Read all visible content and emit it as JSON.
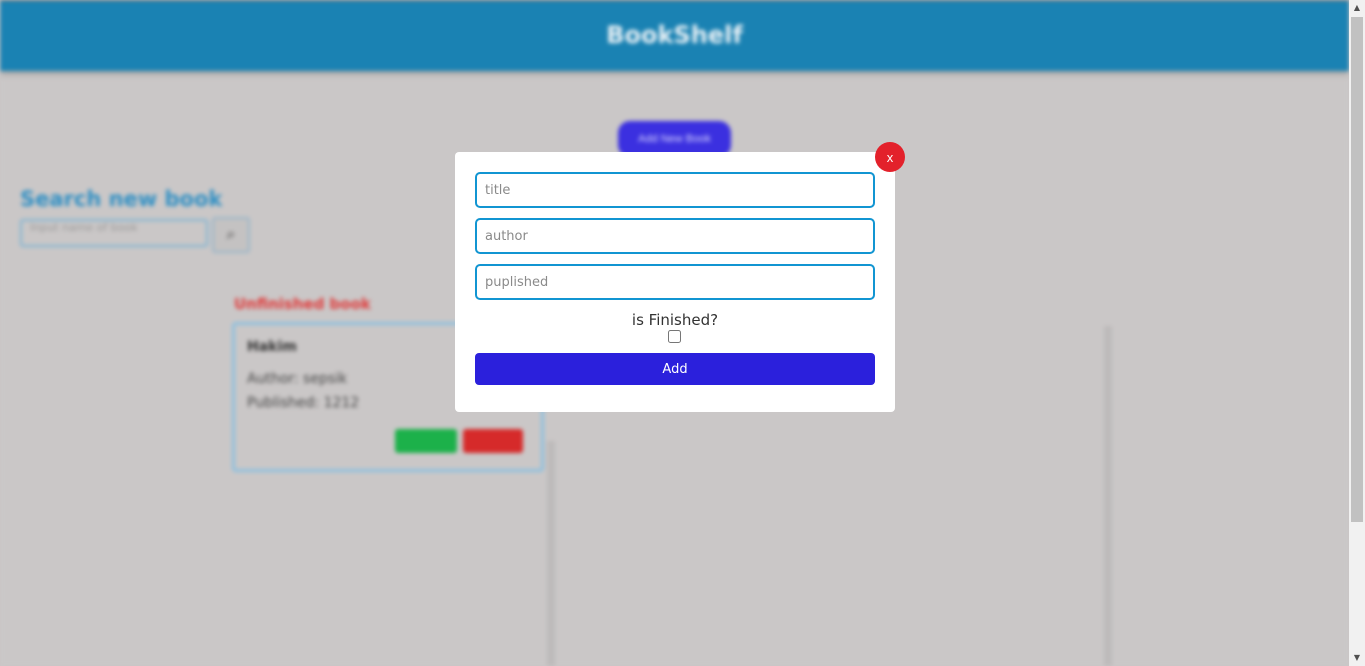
{
  "header": {
    "brand": "BookShelf"
  },
  "main": {
    "add_book_label": "Add New Book",
    "search": {
      "title": "Search new book",
      "placeholder": "Input name of book"
    },
    "unfinished_shelf": {
      "title": "Unfinished book",
      "books": [
        {
          "title": "Hakim",
          "author": "Author: sepsik",
          "published": "Published: 1212"
        }
      ]
    }
  },
  "modal": {
    "close_label": "x",
    "title_placeholder": "title",
    "author_placeholder": "author",
    "published_placeholder": "puplished",
    "finished_label": "is Finished?",
    "add_label": "Add"
  },
  "colors": {
    "header": "#1a82b3",
    "primary_button": "#2b20dc",
    "close_button": "#e3212b",
    "input_border": "#1195d2"
  },
  "icons": {
    "search": "magnifier-icon",
    "scroll_up": "triangle-up",
    "scroll_down": "triangle-down"
  }
}
